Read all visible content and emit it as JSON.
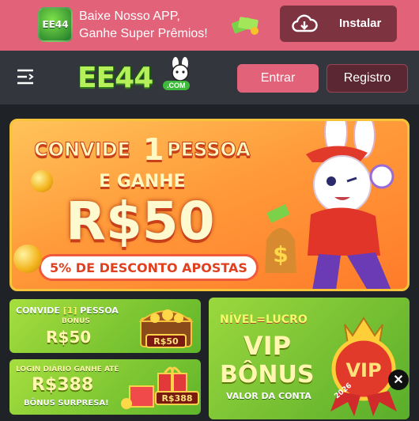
{
  "app_promo": {
    "logo_text": "EE44",
    "line1": "Baixe Nosso APP,",
    "line2": "Ganhe Super Prêmios!",
    "install_label": "Instalar"
  },
  "header": {
    "brand": "EE44",
    "brand_suffix": ".COM",
    "login_label": "Entrar",
    "register_label": "Registro"
  },
  "banner": {
    "line1": "CONVIDE",
    "number": "1",
    "line1_end": "PESSOA",
    "line2": "E GANHE",
    "amount": "R$50",
    "pill": "5% DE DESCONTO APOSTAS"
  },
  "cards": {
    "invite": {
      "title_a": "CONVIDE",
      "title_num": "[1]",
      "title_b": "PESSOA",
      "sub": "BÔNUS",
      "amount": "R$50",
      "tag": "R$50"
    },
    "daily": {
      "title": "LOGIN DIÁRIO GANHE ATÉ",
      "amount": "R$388",
      "sub": "BÔNUS SURPRESA!",
      "tag": "R$388"
    },
    "vip": {
      "top": "NÍVEL=LUCRO",
      "title": "VIP",
      "bonus": "BÔNUS",
      "sub": "VALOR DA CONTA",
      "badge": "VIP",
      "year": "2026"
    }
  },
  "colors": {
    "accent": "#e2627a",
    "register_bg": "#5b2732",
    "card_green": "#7cc634"
  }
}
